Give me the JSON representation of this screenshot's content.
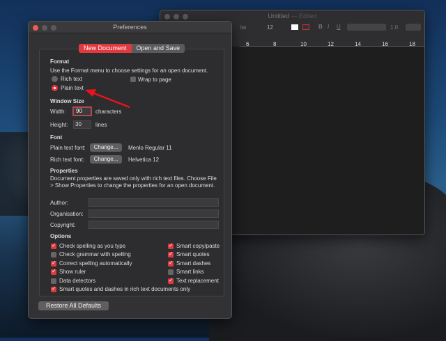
{
  "editor": {
    "title": "Untitled",
    "edited": "— Edited",
    "font_partial": "lar",
    "size": "12",
    "spacing": "1.0",
    "ruler": [
      "6",
      "8",
      "10",
      "12",
      "14",
      "16",
      "18"
    ]
  },
  "prefs": {
    "title": "Preferences",
    "tabs": [
      {
        "label": "New Document",
        "active": true
      },
      {
        "label": "Open and Save",
        "active": false
      }
    ],
    "format": {
      "heading": "Format",
      "desc": "Use the Format menu to choose settings for an open document.",
      "rich": "Rich text",
      "plain": "Plain text",
      "selected": "Plain text",
      "wrap": "Wrap to page",
      "wrap_checked": false
    },
    "window_size": {
      "heading": "Window Size",
      "width_label": "Width:",
      "width": "90",
      "width_unit": "characters",
      "height_label": "Height:",
      "height": "30",
      "height_unit": "lines"
    },
    "font": {
      "heading": "Font",
      "plain_label": "Plain text font:",
      "plain_value": "Menlo Regular 11",
      "rich_label": "Rich text font:",
      "rich_value": "Helvetica 12",
      "change": "Change..."
    },
    "properties": {
      "heading": "Properties",
      "desc": "Document properties are saved only with rich text files. Choose File > Show Properties to change the properties for an open document.",
      "author": "Author:",
      "organisation": "Organisation:",
      "copyright": "Copyright:"
    },
    "options": {
      "heading": "Options",
      "left": [
        {
          "label": "Check spelling as you type",
          "checked": true
        },
        {
          "label": "Check grammar with spelling",
          "checked": false
        },
        {
          "label": "Correct spelling automatically",
          "checked": true
        },
        {
          "label": "Show ruler",
          "checked": true
        },
        {
          "label": "Data detectors",
          "checked": false
        }
      ],
      "right": [
        {
          "label": "Smart copy/paste",
          "checked": true
        },
        {
          "label": "Smart quotes",
          "checked": true
        },
        {
          "label": "Smart dashes",
          "checked": true
        },
        {
          "label": "Smart links",
          "checked": false
        },
        {
          "label": "Text replacement",
          "checked": true
        }
      ],
      "bottom": {
        "label": "Smart quotes and dashes in rich text documents only",
        "checked": true
      }
    },
    "restore": "Restore All Defaults"
  },
  "colors": {
    "accent": "#e0393e",
    "annotation_arrow": "#e8141c"
  }
}
